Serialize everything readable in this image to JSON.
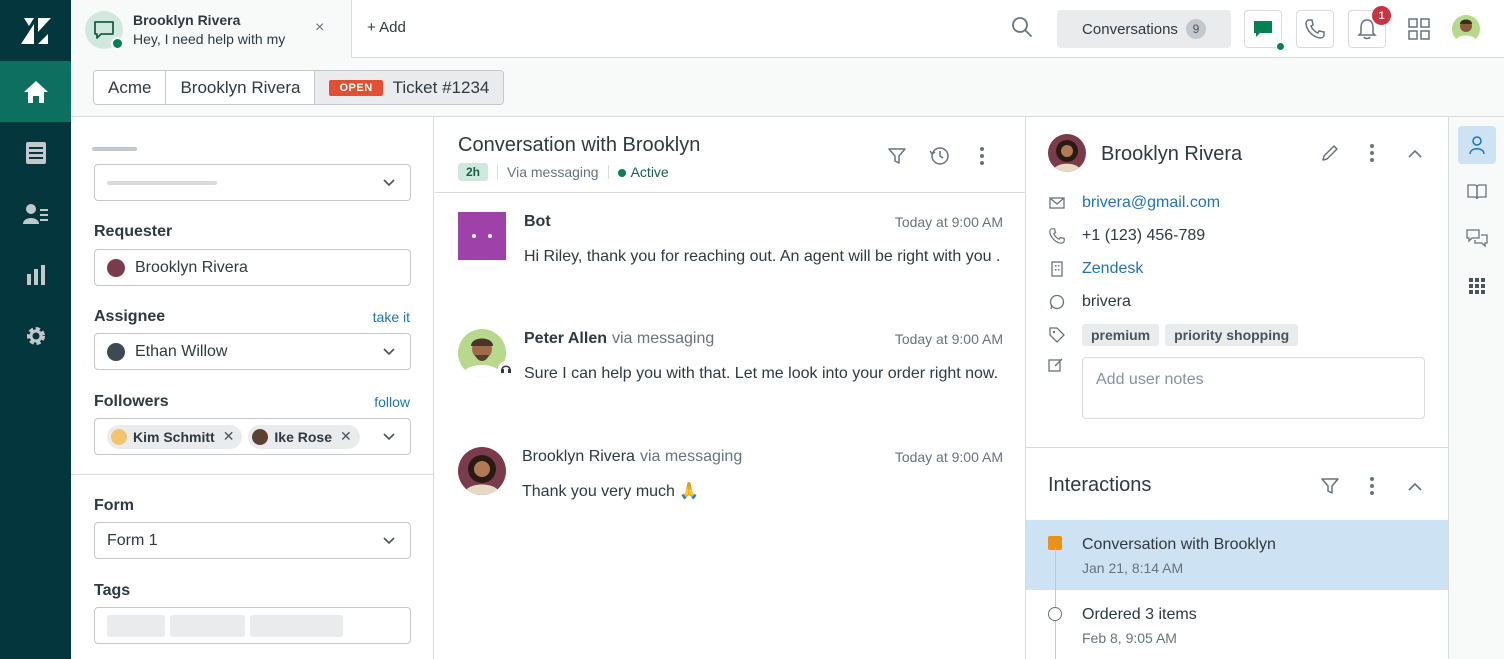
{
  "tab": {
    "name": "Brooklyn Rivera",
    "preview": "Hey, I need help with my",
    "close": "×",
    "add_label": "+ Add"
  },
  "topbar": {
    "conversations_label": "Conversations",
    "conversations_count": "9",
    "notification_count": "1"
  },
  "breadcrumb": {
    "org": "Acme",
    "requester": "Brooklyn Rivera",
    "status": "OPEN",
    "ticket": "Ticket #1234"
  },
  "props": {
    "requester_label": "Requester",
    "requester_value": "Brooklyn Rivera",
    "assignee_label": "Assignee",
    "assignee_link": "take it",
    "assignee_value": "Ethan Willow",
    "followers_label": "Followers",
    "followers_link": "follow",
    "followers": [
      "Kim Schmitt",
      "Ike Rose"
    ],
    "form_label": "Form",
    "form_value": "Form 1",
    "tags_label": "Tags"
  },
  "conversation": {
    "title": "Conversation with Brooklyn",
    "time_chip": "2h",
    "channel": "Via messaging",
    "status": "Active",
    "messages": [
      {
        "sender": "Bot",
        "via": "",
        "time": "Today at 9:00 AM",
        "text": "Hi Riley, thank you for reaching out. An agent will be right with you ."
      },
      {
        "sender": "Peter Allen",
        "via": "via messaging",
        "time": "Today at 9:00 AM",
        "text": "Sure I can help you with that. Let me look into your order right now."
      },
      {
        "sender": "Brooklyn Rivera",
        "via": "via messaging",
        "time": "Today at 9:00 AM",
        "text": "Thank you very much 🙏"
      }
    ]
  },
  "user": {
    "name": "Brooklyn Rivera",
    "email": "brivera@gmail.com",
    "phone": "+1 (123) 456-789",
    "org": "Zendesk",
    "whatsapp": "brivera",
    "tags": [
      "premium",
      "priority shopping"
    ],
    "notes_placeholder": "Add user notes"
  },
  "interactions": {
    "title": "Interactions",
    "items": [
      {
        "title": "Conversation with Brooklyn",
        "date": "Jan 21, 8:14 AM"
      },
      {
        "title": "Ordered 3 items",
        "date": "Feb 8, 9:05 AM"
      }
    ]
  },
  "colors": {
    "nav_bg": "#03363d",
    "nav_active": "#0c6f60",
    "open_badge": "#e34f32",
    "link": "#1f73b7",
    "selected_row": "#cde2f3",
    "bot_avatar": "#9e42a9",
    "accent_orange": "#ed8f1c"
  }
}
